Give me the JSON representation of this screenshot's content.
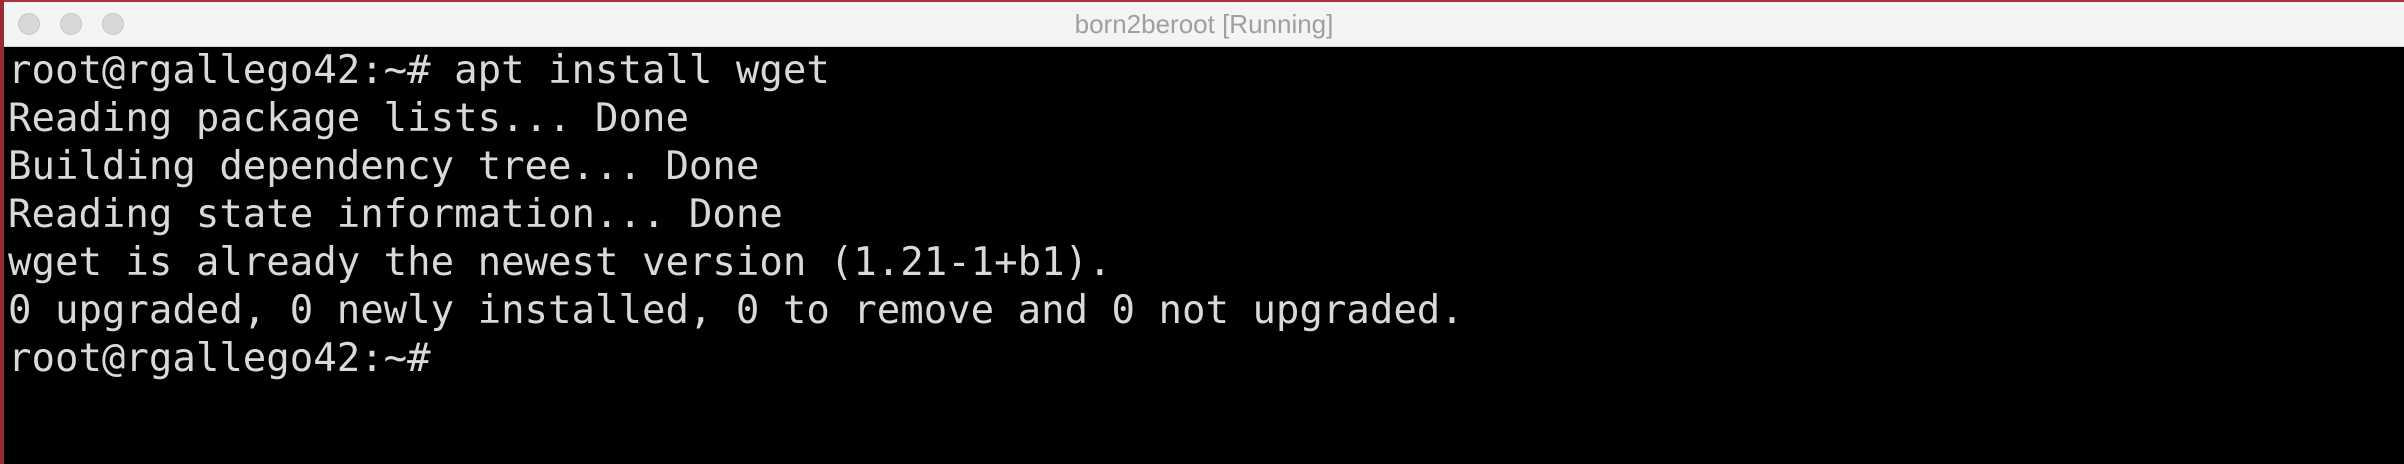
{
  "window": {
    "title": "born2beroot [Running]",
    "controls": {
      "close": "close-button",
      "minimize": "minimize-button",
      "zoom": "zoom-button"
    }
  },
  "terminal": {
    "lines": [
      "root@rgallego42:~# apt install wget",
      "Reading package lists... Done",
      "Building dependency tree... Done",
      "Reading state information... Done",
      "wget is already the newest version (1.21-1+b1).",
      "0 upgraded, 0 newly installed, 0 to remove and 0 not upgraded.",
      "root@rgallego42:~#"
    ]
  },
  "colors": {
    "accent": "#b1313b",
    "terminal_bg": "#000000",
    "terminal_fg": "#d9d9d9",
    "titlebar_bg": "#f5f4f4",
    "title_text": "#9f9f9f"
  }
}
